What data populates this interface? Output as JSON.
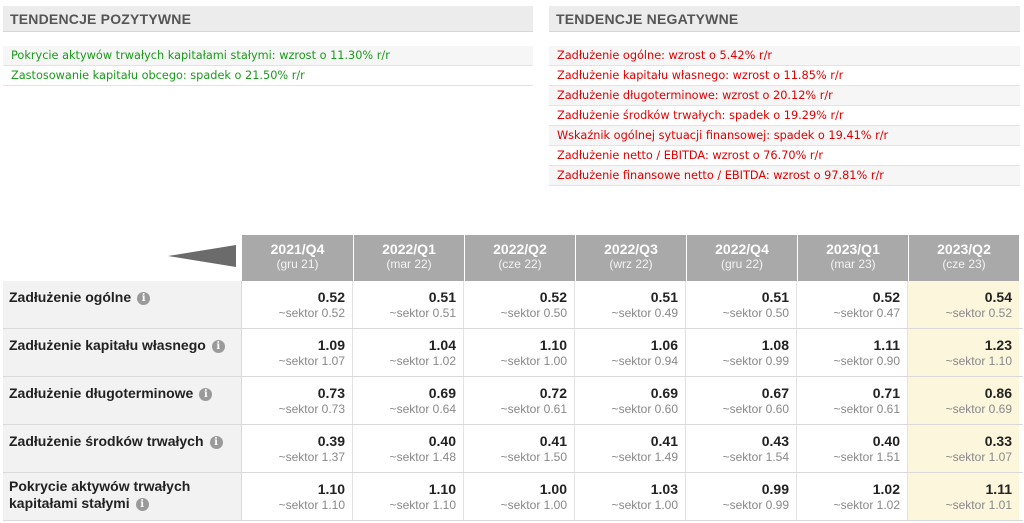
{
  "positive": {
    "title": "TENDENCJE POZYTYWNE",
    "items": [
      "Pokrycie aktywów trwałych kapitałami stałymi: wzrost o 11.30% r/r",
      "Zastosowanie kapitału obcego: spadek o 21.50% r/r"
    ]
  },
  "negative": {
    "title": "TENDENCJE NEGATYWNE",
    "items": [
      "Zadłużenie ogólne: wzrost o 5.42% r/r",
      "Zadłużenie kapitału własnego: wzrost o 11.85% r/r",
      "Zadłużenie długoterminowe: wzrost o 20.12% r/r",
      "Zadłużenie środków trwałych: spadek o 19.29% r/r",
      "Wskaźnik ogólnej sytuacji finansowej: spadek o 19.41% r/r",
      "Zadłużenie netto / EBITDA: wzrost o 76.70% r/r",
      "Zadłużenie finansowe netto / EBITDA: wzrost o 97.81% r/r"
    ]
  },
  "colors": {
    "positive": "#1a9a1a",
    "negative": "#e00000",
    "header_bg": "#a9a9a9",
    "highlight": "#fbf6dc"
  },
  "table": {
    "periods": [
      {
        "name": "2021/Q4",
        "date": "(gru 21)"
      },
      {
        "name": "2022/Q1",
        "date": "(mar 22)"
      },
      {
        "name": "2022/Q2",
        "date": "(cze 22)"
      },
      {
        "name": "2022/Q3",
        "date": "(wrz 22)"
      },
      {
        "name": "2022/Q4",
        "date": "(gru 22)"
      },
      {
        "name": "2023/Q1",
        "date": "(mar 23)"
      },
      {
        "name": "2023/Q2",
        "date": "(cze 23)"
      }
    ],
    "info_icon": "i",
    "rows": [
      {
        "label": "Zadłużenie ogólne",
        "cells": [
          {
            "value": "0.52",
            "sector": "~sektor 0.52"
          },
          {
            "value": "0.51",
            "sector": "~sektor 0.51"
          },
          {
            "value": "0.52",
            "sector": "~sektor 0.50"
          },
          {
            "value": "0.51",
            "sector": "~sektor 0.49"
          },
          {
            "value": "0.51",
            "sector": "~sektor 0.50"
          },
          {
            "value": "0.52",
            "sector": "~sektor 0.47"
          },
          {
            "value": "0.54",
            "sector": "~sektor 0.52"
          }
        ]
      },
      {
        "label": "Zadłużenie kapitału własnego",
        "cells": [
          {
            "value": "1.09",
            "sector": "~sektor 1.07"
          },
          {
            "value": "1.04",
            "sector": "~sektor 1.02"
          },
          {
            "value": "1.10",
            "sector": "~sektor 1.00"
          },
          {
            "value": "1.06",
            "sector": "~sektor 0.94"
          },
          {
            "value": "1.08",
            "sector": "~sektor 0.99"
          },
          {
            "value": "1.11",
            "sector": "~sektor 0.90"
          },
          {
            "value": "1.23",
            "sector": "~sektor 1.10"
          }
        ]
      },
      {
        "label": "Zadłużenie długoterminowe",
        "cells": [
          {
            "value": "0.73",
            "sector": "~sektor 0.73"
          },
          {
            "value": "0.69",
            "sector": "~sektor 0.64"
          },
          {
            "value": "0.72",
            "sector": "~sektor 0.61"
          },
          {
            "value": "0.69",
            "sector": "~sektor 0.60"
          },
          {
            "value": "0.67",
            "sector": "~sektor 0.60"
          },
          {
            "value": "0.71",
            "sector": "~sektor 0.61"
          },
          {
            "value": "0.86",
            "sector": "~sektor 0.69"
          }
        ]
      },
      {
        "label": "Zadłużenie środków trwałych",
        "cells": [
          {
            "value": "0.39",
            "sector": "~sektor 1.37"
          },
          {
            "value": "0.40",
            "sector": "~sektor 1.48"
          },
          {
            "value": "0.41",
            "sector": "~sektor 1.50"
          },
          {
            "value": "0.41",
            "sector": "~sektor 1.49"
          },
          {
            "value": "0.43",
            "sector": "~sektor 1.54"
          },
          {
            "value": "0.40",
            "sector": "~sektor 1.51"
          },
          {
            "value": "0.33",
            "sector": "~sektor 1.07"
          }
        ]
      },
      {
        "label_line1": "Pokrycie aktywów trwałych",
        "label_line2": "kapitałami stałymi",
        "cells": [
          {
            "value": "1.10",
            "sector": "~sektor 1.10"
          },
          {
            "value": "1.10",
            "sector": "~sektor 1.10"
          },
          {
            "value": "1.00",
            "sector": "~sektor 1.00"
          },
          {
            "value": "1.03",
            "sector": "~sektor 1.00"
          },
          {
            "value": "0.99",
            "sector": "~sektor 0.99"
          },
          {
            "value": "1.02",
            "sector": "~sektor 1.02"
          },
          {
            "value": "1.11",
            "sector": "~sektor 1.01"
          }
        ]
      }
    ]
  }
}
